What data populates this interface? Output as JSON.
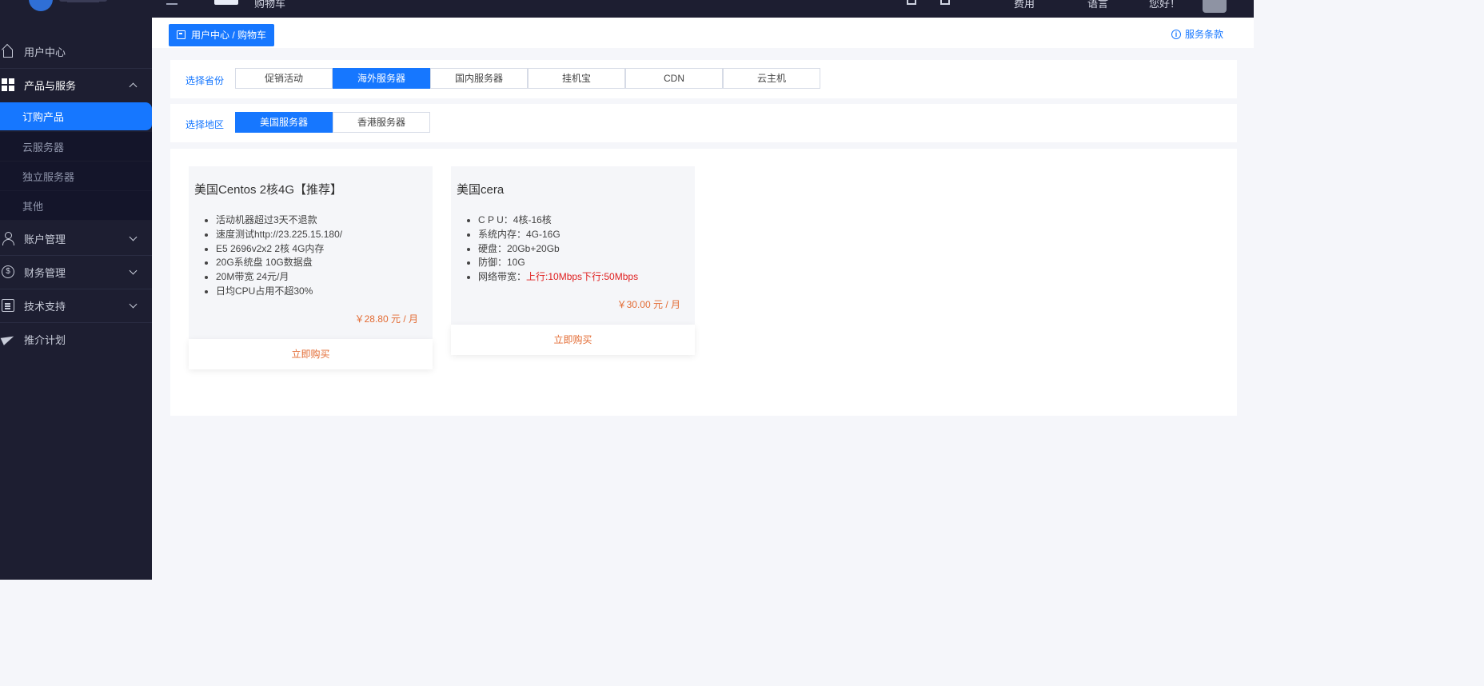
{
  "topbar": {
    "cart_label": "购物车",
    "fee_label": "费用",
    "language_label": "语言",
    "greeting": "您好！"
  },
  "sidebar": {
    "items": [
      {
        "label": "用户中心",
        "icon": "home-icon"
      },
      {
        "label": "产品与服务",
        "icon": "grid-icon",
        "open": true
      },
      {
        "label": "账户管理",
        "icon": "user-icon"
      },
      {
        "label": "财务管理",
        "icon": "money-icon"
      },
      {
        "label": "技术支持",
        "icon": "document-icon"
      },
      {
        "label": "推介计划",
        "icon": "send-icon"
      }
    ],
    "sub_items": [
      "订购产品",
      "云服务器",
      "独立服务器",
      "其他"
    ],
    "money_glyph": "$"
  },
  "header": {
    "breadcrumb": "用户中心 / 购物车",
    "terms_label": "服务条款",
    "terms_glyph": "i"
  },
  "filters": {
    "province_label": "选择省份",
    "province_options": [
      "促销活动",
      "海外服务器",
      "国内服务器",
      "挂机宝",
      "CDN",
      "云主机"
    ],
    "province_selected": "海外服务器",
    "region_label": "选择地区",
    "region_options": [
      "美国服务器",
      "香港服务器"
    ],
    "region_selected": "美国服务器"
  },
  "products": [
    {
      "title": "美国Centos 2核4G【推荐】",
      "features": [
        "活动机器超过3天不退款",
        "速度测试http://23.225.15.180/",
        "E5 2696v2x2 2核 4G内存",
        "20G系统盘 10G数据盘",
        "20M带宽 24元/月",
        "日均CPU占用不超30%"
      ],
      "price": "￥28.80 元 / 月",
      "buy_label": "立即购买"
    },
    {
      "title": "美国cera",
      "features": [
        "C P U：4核-16核",
        "系统内存：4G-16G",
        "硬盘：20Gb+20Gb",
        "防御：10G"
      ],
      "bandwidth_label": "网络带宽：",
      "bandwidth_value": "上行:10Mbps下行:50Mbps",
      "price": "￥30.00 元 / 月",
      "buy_label": "立即购买"
    }
  ],
  "colors": {
    "accent": "#1677ff",
    "sidebar_bg": "#1d1e31",
    "price": "#e36b33",
    "highlight_red": "#e02020"
  }
}
